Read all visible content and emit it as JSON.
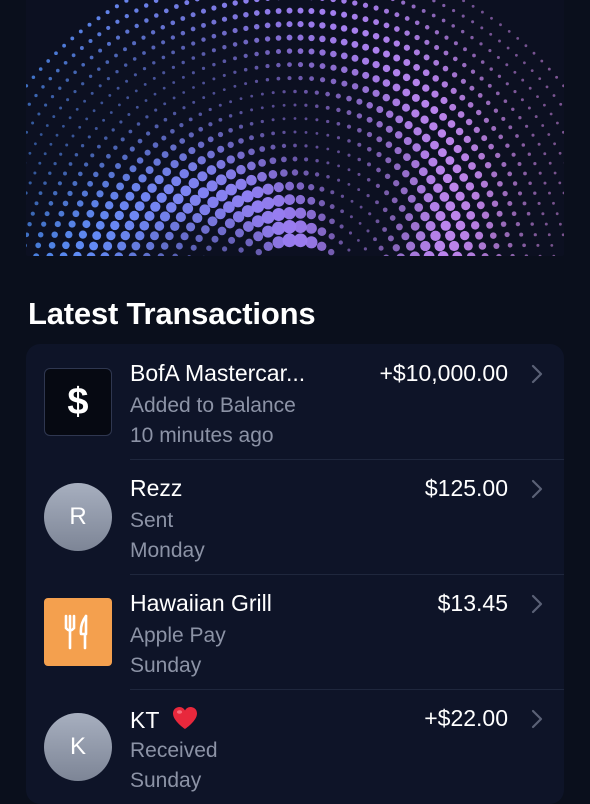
{
  "section_title": "Latest Transactions",
  "colors": {
    "background": "#0a0f1c",
    "list_bg": "#0e1428",
    "muted_text": "#8c93a6",
    "food_icon": "#f4a04e",
    "dots_gradient": [
      "#4f8ef5",
      "#9b7cf0",
      "#d38ae8"
    ]
  },
  "transactions": [
    {
      "icon": "dollar-icon",
      "name": "BofA Mastercar...",
      "subtitle": "Added to Balance",
      "time": "10 minutes ago",
      "amount": "+$10,000.00"
    },
    {
      "icon": "avatar",
      "initial": "R",
      "name": "Rezz",
      "subtitle": "Sent",
      "time": "Monday",
      "amount": "$125.00"
    },
    {
      "icon": "fork-knife-icon",
      "name": "Hawaiian Grill",
      "subtitle": "Apple Pay",
      "time": "Sunday",
      "amount": "$13.45"
    },
    {
      "icon": "avatar",
      "initial": "K",
      "name": "KT",
      "name_emoji": "heart-icon",
      "subtitle": "Received",
      "time": "Sunday",
      "amount": "+$22.00"
    }
  ]
}
